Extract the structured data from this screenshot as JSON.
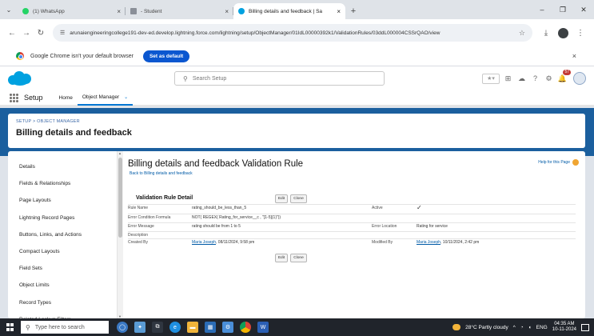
{
  "browser": {
    "tabs": [
      {
        "label": "(1) WhatsApp",
        "color": "#25d366"
      },
      {
        "label": "- Student",
        "color": "#8a8f98"
      },
      {
        "label": "Billing details and feedback | Sa",
        "color": "#00a1e0"
      }
    ],
    "url": "arunaiengineeringcollege191-dev-ed.develop.lightning.force.com/lightning/setup/ObjectManager/01IdL00000392k1/ValidationRules/03ddL000004CSSrQAO/view",
    "infobar_message": "Google Chrome isn't your default browser",
    "infobar_button": "Set as default"
  },
  "sf": {
    "search_placeholder": "Search Setup",
    "notification_count": "57",
    "app_name": "Setup",
    "nav_home": "Home",
    "nav_object_manager": "Object Manager"
  },
  "header": {
    "breadcrumb": "SETUP > OBJECT MANAGER",
    "object_title": "Billing details and feedback"
  },
  "sidebar": {
    "items": [
      "Details",
      "Fields & Relationships",
      "Page Layouts",
      "Lightning Record Pages",
      "Buttons, Links, and Actions",
      "Compact Layouts",
      "Field Sets",
      "Object Limits",
      "Record Types",
      "Related Lookup Filters"
    ]
  },
  "rule": {
    "title": "Billing details and feedback Validation Rule",
    "back_link": "Back to Billing details and feedback",
    "help_link": "Help for this Page",
    "section_title": "Validation Rule Detail",
    "edit_label": "Edit",
    "clone_label": "Clone",
    "fields": {
      "rule_name_label": "Rule Name",
      "rule_name_value": "rating_should_be_less_than_5",
      "active_label": "Active",
      "active_value": "✓",
      "formula_label": "Error Condition Formula",
      "formula_value": "NOT( REGEX( Rating_for_service__c , \"[1-5]{1}\"))",
      "message_label": "Error Message",
      "message_value": "rating should be from 1 to 5",
      "location_label": "Error Location",
      "location_value": "Rating for service",
      "description_label": "Description",
      "created_by_label": "Created By",
      "created_by_name": "Maria Joseph",
      "created_by_date": ", 08/11/2024, 9:58 pm",
      "modified_by_label": "Modified By",
      "modified_by_name": "Maria Joseph",
      "modified_by_date": ", 10/11/2024, 2:42 pm"
    }
  },
  "taskbar": {
    "search_placeholder": "Type here to search",
    "weather": "28°C  Partly cloudy",
    "language": "ENG",
    "time": "04:35 AM",
    "date": "10-11-2024"
  }
}
